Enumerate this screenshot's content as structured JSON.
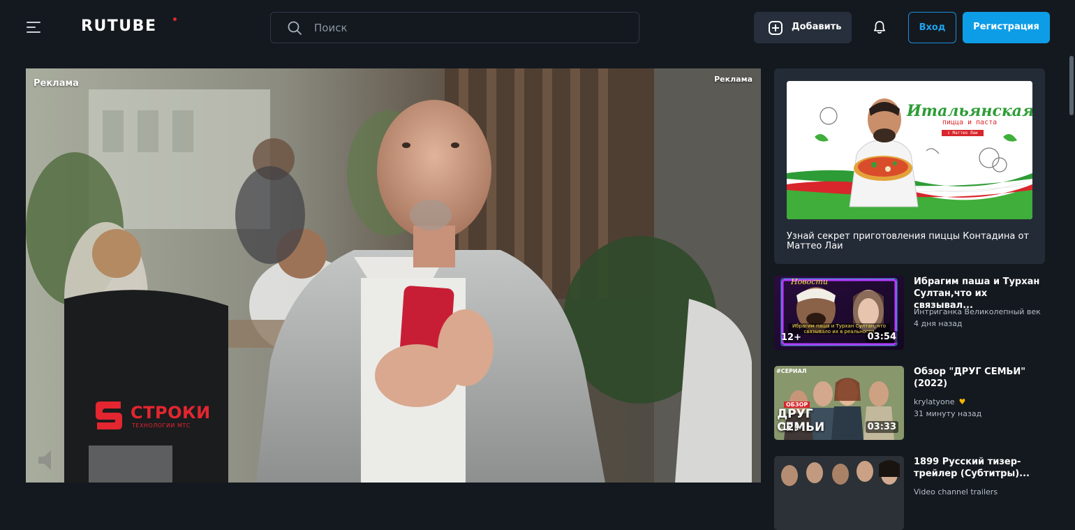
{
  "header": {
    "logo_text": "RUTUBE",
    "search_placeholder": "Поиск",
    "add_label": "Добавить",
    "login_label": "Вход",
    "register_label": "Регистрация"
  },
  "player": {
    "ad_label_left": "Реклама",
    "ad_label_right": "Реклама",
    "brand_name": "СТРОКИ",
    "brand_sub": "ТЕХНОЛОГИИ МТС"
  },
  "ad_card": {
    "banner_title": "Итальянская",
    "banner_subtitle": "пицца и паста",
    "banner_tag": "с Маттео Лаи",
    "text": "Узнай секрет приготовления пиццы Контадина от Маттео Лаи"
  },
  "recommendations": [
    {
      "title": "Ибрагим паша и Турхан Султан,что их связывал...",
      "channel": "Интриганка Великолепный век",
      "date": "4 дня назад",
      "age": "12+",
      "duration": "03:54",
      "thumb_label": "Новости",
      "thumb_caption": "Ибрагим паша и Турхан Султан, что связывало их в реальности"
    },
    {
      "title": "Обзор \"ДРУГ СЕМЬИ\" (2022)",
      "channel": "krylatyone",
      "date": "31 минуту назад",
      "age": "12+",
      "duration": "03:33",
      "thumb_tag": "#СЕРИАЛ",
      "thumb_badge": "ОБЗОР",
      "thumb_caption": "ДРУГ СЕМЬИ"
    },
    {
      "title": "1899 Русский тизер-трейлер (Субтитры)...",
      "channel": "Video channel trailers",
      "date": ""
    }
  ],
  "colors": {
    "background": "#14191f",
    "accent": "#0d9de7",
    "logo_dot": "#e3262f",
    "brand_red": "#e3262f"
  }
}
